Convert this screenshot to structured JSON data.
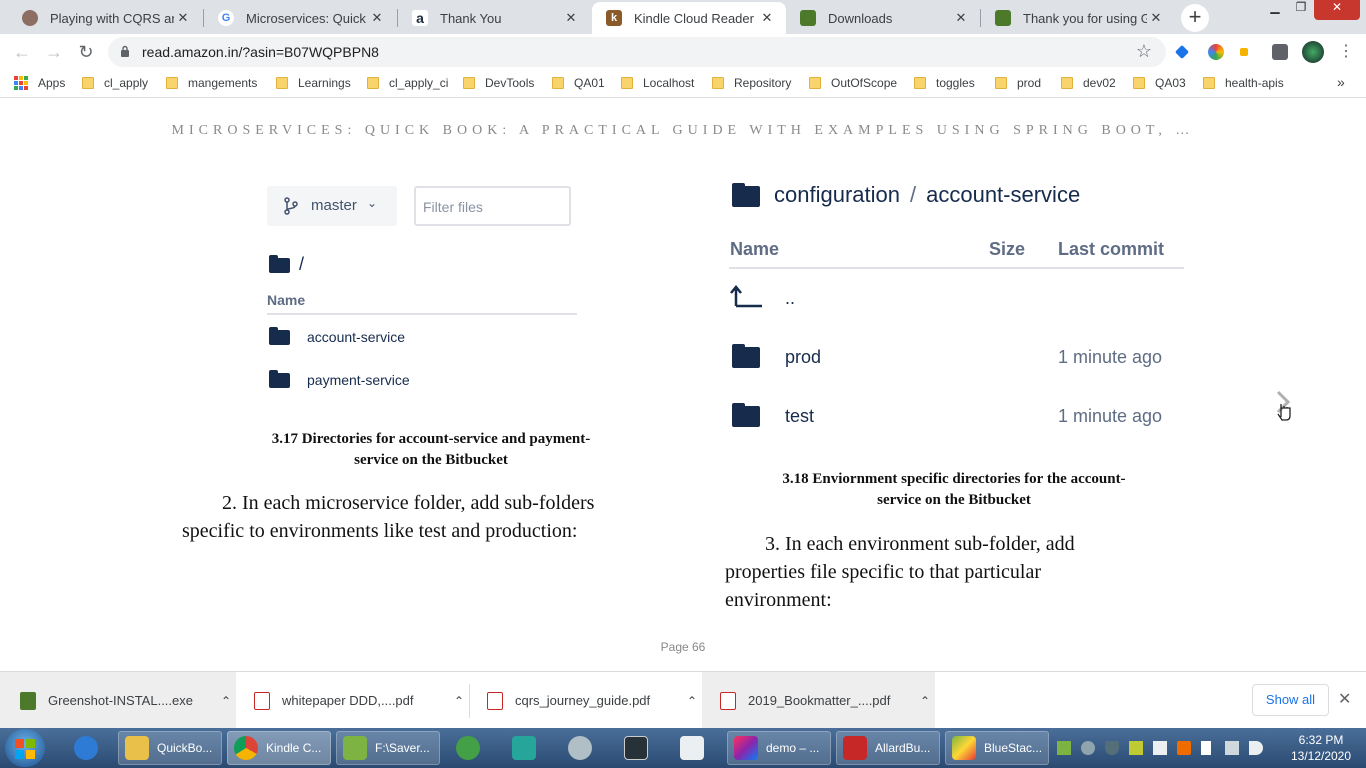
{
  "browser": {
    "tabs": [
      {
        "title": "Playing with CQRS and E",
        "favicon": "avatar-icon",
        "color": "#8d6e63",
        "active": false
      },
      {
        "title": "Microservices: Quick Boo",
        "favicon": "google-icon",
        "color": "#4285f4",
        "active": false
      },
      {
        "title": "Thank You",
        "favicon": "amazon-icon",
        "color": "#232f3e",
        "active": false
      },
      {
        "title": "Kindle Cloud Reader",
        "favicon": "kindle-icon",
        "color": "#8a5a2b",
        "active": true
      },
      {
        "title": "Downloads",
        "favicon": "greenshot-icon",
        "color": "#4c7a2a",
        "active": false
      },
      {
        "title": "Thank you for using Gre",
        "favicon": "greenshot-icon",
        "color": "#4c7a2a",
        "active": false
      }
    ],
    "address": "read.amazon.in/?asin=B07WQPBPN8",
    "bookmarks": {
      "apps_label": "Apps",
      "items": [
        "cl_apply",
        "mangements",
        "Learnings",
        "cl_apply_ci",
        "DevTools",
        "QA01",
        "Localhost",
        "Repository",
        "OutOfScope",
        "toggles",
        "prod",
        "dev02",
        "QA03",
        "health-apis"
      ],
      "more": "»"
    }
  },
  "reader": {
    "book_title": "MICROSERVICES: QUICK BOOK: A PRACTICAL GUIDE WITH EXAMPLES USING SPRING BOOT, …",
    "left_figure": {
      "branch": "master",
      "filter_placeholder": "Filter files",
      "root": "/",
      "header": "Name",
      "items": [
        "account-service",
        "payment-service"
      ]
    },
    "left_caption": [
      "3.17 Directories for account-service and payment-",
      "service on the Bitbucket"
    ],
    "left_paragraph": [
      "2. In each microservice folder, add sub-folders",
      "specific to environments like test and production:"
    ],
    "right_figure": {
      "crumb_root": "configuration",
      "crumb_sep": "/",
      "crumb_current": "account-service",
      "headers": {
        "name": "Name",
        "size": "Size",
        "last_commit": "Last commit"
      },
      "parent": "..",
      "rows": [
        {
          "name": "prod",
          "commit": "1 minute ago"
        },
        {
          "name": "test",
          "commit": "1 minute ago"
        }
      ]
    },
    "right_caption": [
      "3.18 Enviornment specific directories for the account-",
      "service on the Bitbucket"
    ],
    "right_paragraph": [
      "3. In each environment sub-folder, add",
      "properties file specific to that particular",
      "environment:"
    ],
    "page_label": "Page 66"
  },
  "downloads": {
    "items": [
      {
        "name": "Greenshot-INSTAL....exe",
        "type": "exe"
      },
      {
        "name": "whitepaper DDD,....pdf",
        "type": "pdf"
      },
      {
        "name": "cqrs_journey_guide.pdf",
        "type": "pdf"
      },
      {
        "name": "2019_Bookmatter_....pdf",
        "type": "pdf"
      }
    ],
    "show_all": "Show all"
  },
  "taskbar": {
    "items": [
      {
        "label": "",
        "icon": "browser-icon",
        "color": "#2e7bd6"
      },
      {
        "label": "QuickBo...",
        "icon": "folder-icon",
        "color": "#e8c04a"
      },
      {
        "label": "Kindle C...",
        "icon": "chrome-icon",
        "color": "#db4437"
      },
      {
        "label": "F:\\Saver...",
        "icon": "notepad-icon",
        "color": "#7cb342"
      },
      {
        "label": "",
        "icon": "clock-app-icon",
        "color": "#43a047"
      },
      {
        "label": "",
        "icon": "editor-icon",
        "color": "#26a69a"
      },
      {
        "label": "",
        "icon": "snip-icon",
        "color": "#b0bec5"
      },
      {
        "label": "",
        "icon": "console-icon",
        "color": "#263238"
      },
      {
        "label": "",
        "icon": "data-icon",
        "color": "#eceff1"
      },
      {
        "label": "demo – ...",
        "icon": "intellij-icon",
        "color": "#8e24aa"
      },
      {
        "label": "AllardBu...",
        "icon": "pdf-icon",
        "color": "#c62828"
      },
      {
        "label": "BlueStac...",
        "icon": "bluestacks-icon",
        "color": "#7cb342"
      }
    ],
    "time": "6:32 PM",
    "date": "13/12/2020"
  }
}
